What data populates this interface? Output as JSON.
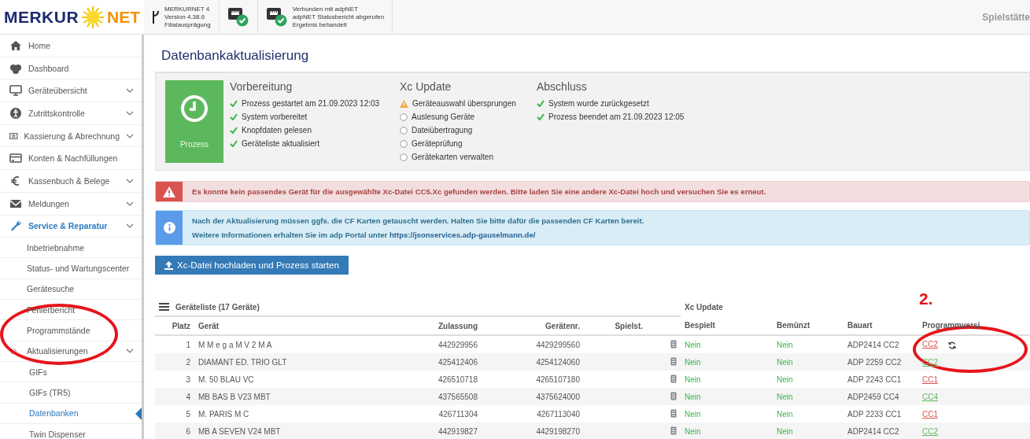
{
  "header": {
    "logo": {
      "left": "MERKUR",
      "right": "NET"
    },
    "version_lines": [
      "MERKURNET 4",
      "Version 4.38.6",
      "Filialausprägung"
    ],
    "connection_lines": [
      "Verbunden mit adpNET",
      "adpNET Statusbericht abgerufen",
      "Ergebnis behandelt"
    ],
    "site": "Spielstätte"
  },
  "sidebar": {
    "items": [
      {
        "label": "Home",
        "expandable": false,
        "expanded": false,
        "selected": false
      },
      {
        "label": "Dashboard",
        "expandable": false,
        "expanded": false,
        "selected": false
      },
      {
        "label": "Geräteübersicht",
        "expandable": true,
        "expanded": false,
        "selected": false
      },
      {
        "label": "Zutrittskontrolle",
        "expandable": true,
        "expanded": false,
        "selected": false
      },
      {
        "label": "Kassierung & Abrechnung",
        "expandable": true,
        "expanded": false,
        "selected": false
      },
      {
        "label": "Konten & Nachfüllungen",
        "expandable": false,
        "expanded": false,
        "selected": false
      },
      {
        "label": "Kassenbuch & Belege",
        "expandable": true,
        "expanded": false,
        "selected": false
      },
      {
        "label": "Meldungen",
        "expandable": true,
        "expanded": false,
        "selected": false
      },
      {
        "label": "Service & Reparatur",
        "expandable": true,
        "expanded": true,
        "selected": false,
        "children": [
          {
            "label": "Inbetriebnahme",
            "expandable": false,
            "expanded": false,
            "selected": false
          },
          {
            "label": "Status- und Wartungscenter",
            "expandable": false,
            "expanded": false,
            "selected": false
          },
          {
            "label": "Gerätesuche",
            "expandable": false,
            "expanded": false,
            "selected": false
          },
          {
            "label": "Fehlerbericht",
            "expandable": false,
            "expanded": false,
            "selected": false
          },
          {
            "label": "Programmstände",
            "expandable": false,
            "expanded": false,
            "selected": false
          },
          {
            "label": "Aktualisierungen",
            "expandable": true,
            "expanded": true,
            "selected": false,
            "children": [
              {
                "label": "GIFs",
                "expandable": false,
                "expanded": false,
                "selected": false
              },
              {
                "label": "GIFs (TR5)",
                "expandable": false,
                "expanded": false,
                "selected": false
              },
              {
                "label": "Datenbanken",
                "expandable": false,
                "expanded": false,
                "selected": true
              },
              {
                "label": "Twin Dispenser",
                "expandable": false,
                "expanded": false,
                "selected": false
              }
            ]
          }
        ]
      }
    ]
  },
  "page_title": "Datenbankaktualisierung",
  "process": {
    "label": "Prozess",
    "phases": [
      {
        "title": "Vorbereitung",
        "steps": [
          {
            "text": "Prozess gestartet am 21.09.2023 12:03",
            "kind": "done"
          },
          {
            "text": "System vorbereitet",
            "kind": "done"
          },
          {
            "text": "Knopfdaten gelesen",
            "kind": "done"
          },
          {
            "text": "Geräteliste aktualisiert",
            "kind": "done"
          }
        ]
      },
      {
        "title": "Xc Update",
        "steps": [
          {
            "text": "Geräteauswahl übersprungen",
            "kind": "warning"
          },
          {
            "text": "Auslesung Geräte",
            "kind": "pending"
          },
          {
            "text": "Dateiübertragung",
            "kind": "pending"
          },
          {
            "text": "Geräteprüfung",
            "kind": "pending"
          },
          {
            "text": "Gerätekarten verwalten",
            "kind": "pending"
          }
        ]
      },
      {
        "title": "Abschluss",
        "steps": [
          {
            "text": "System wurde zurückgesetzt",
            "kind": "done"
          },
          {
            "text": "Prozess beendet am 21.09.2023 12:05",
            "kind": "done"
          }
        ]
      }
    ]
  },
  "alerts": [
    {
      "kind": "error",
      "lines": [
        "Es konnte kein passendes Gerät für die ausgewählte Xc-Datei CC5.Xc gefunden werden. Bitte laden Sie eine andere Xc-Datei hoch und versuchen Sie es erneut."
      ]
    },
    {
      "kind": "info",
      "lines": [
        "Nach der Aktualisierung müssen ggfs. die CF Karten getauscht werden. Halten Sie bitte dafür die passenden CF Karten bereit."
      ],
      "link_prefix": "Weitere Informationen erhalten Sie im adp Portal unter",
      "link": "https://jsonservices.adp-gauselmann.de/"
    }
  ],
  "upload_button": "Xc-Datei hochladen und Prozess starten",
  "table": {
    "title": "Geräteliste (17 Geräte)",
    "group_header": "Xc Update",
    "columns": [
      "Platz",
      "Gerät",
      "Zulassung",
      "Gerätenr.",
      "Spielst.",
      "Bespielt",
      "Bemünzt",
      "Bauart",
      "Programmversi"
    ],
    "rows": [
      {
        "platz": "1",
        "geraet": "M M e g a M V 2 M A",
        "zulassung": "442929956",
        "geraetenr": "4429299560",
        "bespielt": "Nein",
        "bemuenzt": "Nein",
        "bauart": "ADP2414 CC2",
        "version": "CC2",
        "color": "#d9534f",
        "refresh": true
      },
      {
        "platz": "2",
        "geraet": "DIAMANT ED. TRIO GLT",
        "zulassung": "425412406",
        "geraetenr": "4254124060",
        "bespielt": "Nein",
        "bemuenzt": "Nein",
        "bauart": "ADP 2259 CC2",
        "version": "CC2",
        "color": "#5cb85c",
        "refresh": false
      },
      {
        "platz": "3",
        "geraet": "M. 50 BLAU VC",
        "zulassung": "426510718",
        "geraetenr": "4265107180",
        "bespielt": "Nein",
        "bemuenzt": "Nein",
        "bauart": "ADP 2243 CC1",
        "version": "CC1",
        "color": "#d9534f",
        "refresh": false
      },
      {
        "platz": "4",
        "geraet": "MB BAS B V23 MBT",
        "zulassung": "437565508",
        "geraetenr": "4375624000",
        "bespielt": "Nein",
        "bemuenzt": "Nein",
        "bauart": "ADP2459 CC4",
        "version": "CC4",
        "color": "#5cb85c",
        "refresh": false
      },
      {
        "platz": "5",
        "geraet": "M. PARIS M C",
        "zulassung": "426711304",
        "geraetenr": "4267113040",
        "bespielt": "Nein",
        "bemuenzt": "Nein",
        "bauart": "ADP 2233 CC1",
        "version": "CC1",
        "color": "#d9534f",
        "refresh": false
      },
      {
        "platz": "6",
        "geraet": "MB A SEVEN V24 MBT",
        "zulassung": "442919827",
        "geraetenr": "4429198270",
        "bespielt": "Nein",
        "bemuenzt": "Nein",
        "bauart": "ADP2414 CC2",
        "version": "CC2",
        "color": "#5cb85c",
        "refresh": false
      }
    ]
  },
  "annotations": [
    {
      "kind": "circle"
    },
    {
      "kind": "circle"
    },
    {
      "kind": "label",
      "text": "2."
    }
  ]
}
